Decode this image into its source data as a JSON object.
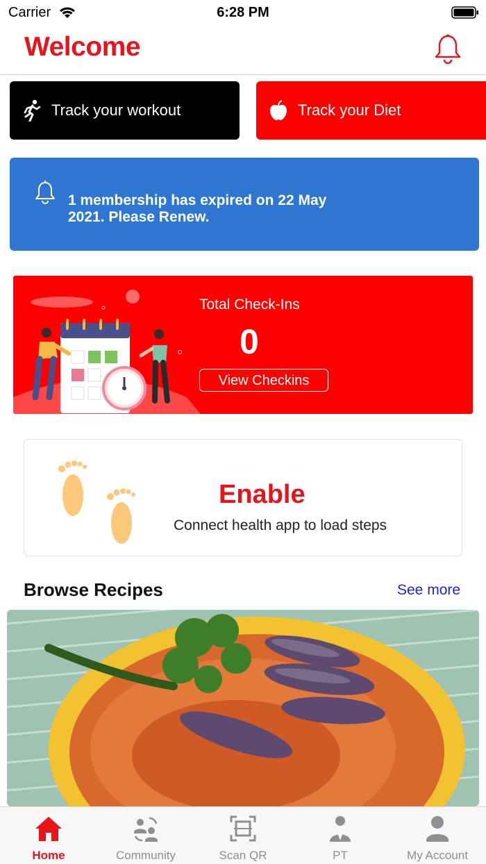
{
  "status": {
    "carrier": "Carrier",
    "time": "6:28 PM"
  },
  "header": {
    "title": "Welcome",
    "icon": "bell-icon"
  },
  "track": {
    "workout_label": "Track your workout",
    "workout_icon": "running-person-icon",
    "diet_label": "Track your Diet",
    "diet_icon": "apple-icon"
  },
  "alert": {
    "message": "1 membership has expired on 22 May 2021. Please Renew.",
    "icon": "bell-outline-icon"
  },
  "checkins": {
    "label": "Total Check-Ins",
    "count": "0",
    "button_label": "View Checkins"
  },
  "steps": {
    "title": "Enable",
    "subtitle": "Connect health app to load steps",
    "icon": "footprints-icon"
  },
  "recipes": {
    "title": "Browse Recipes",
    "see_more": "See more",
    "image": "eggplant-curry-photo"
  },
  "tabs": [
    {
      "label": "Home",
      "icon": "home-icon",
      "active": true
    },
    {
      "label": "Community",
      "icon": "community-icon",
      "active": false
    },
    {
      "label": "Scan QR",
      "icon": "scan-qr-icon",
      "active": false
    },
    {
      "label": "PT",
      "icon": "trainer-icon",
      "active": false
    },
    {
      "label": "My Account",
      "icon": "account-icon",
      "active": false
    }
  ],
  "colors": {
    "brand_red": "#e8141b",
    "alert_blue": "#2f76d2",
    "link_blue": "#1a22e6",
    "tab_inactive": "#8e8e93"
  }
}
